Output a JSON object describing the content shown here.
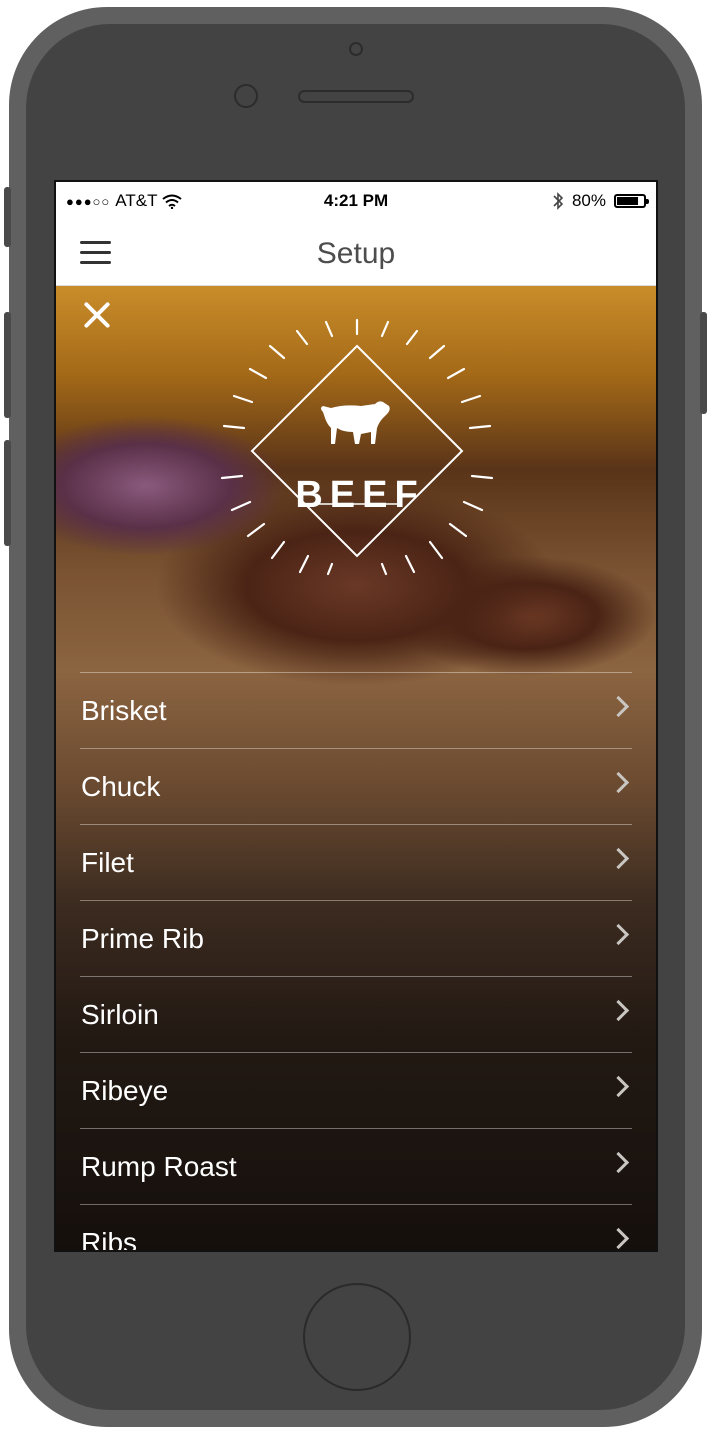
{
  "status_bar": {
    "carrier": "AT&T",
    "signal_dots": "●●●○○",
    "time": "4:21 PM",
    "battery": "80%",
    "battery_fill": 0.8
  },
  "nav": {
    "title": "Setup"
  },
  "hero": {
    "logo_text": "BEEF"
  },
  "icons": {
    "menu": "hamburger-menu-icon",
    "close": "close-icon",
    "chevron": "chevron-right-icon",
    "wifi": "wifi-icon",
    "bluetooth": "bluetooth-icon",
    "cow": "cow-icon"
  },
  "cuts": [
    {
      "label": "Brisket"
    },
    {
      "label": "Chuck"
    },
    {
      "label": "Filet"
    },
    {
      "label": "Prime Rib"
    },
    {
      "label": "Sirloin"
    },
    {
      "label": "Ribeye"
    },
    {
      "label": "Rump Roast"
    },
    {
      "label": "Ribs"
    }
  ]
}
